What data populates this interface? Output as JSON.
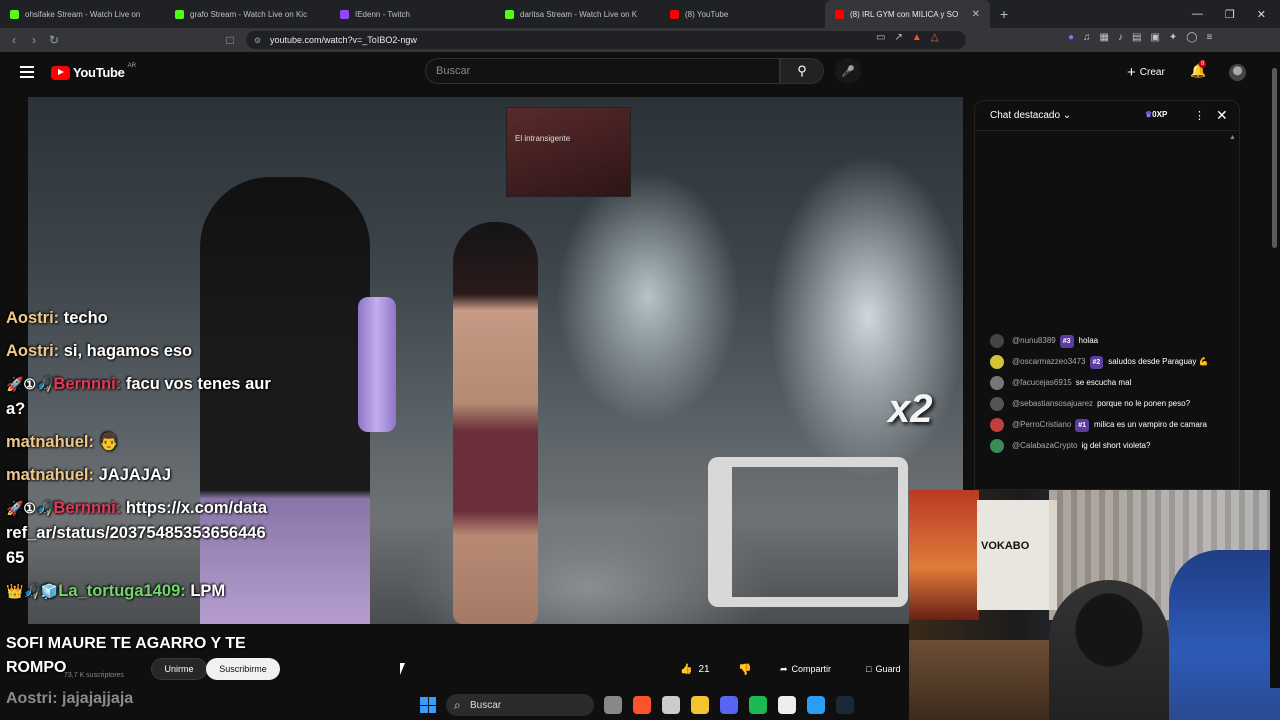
{
  "browser": {
    "tabs": [
      {
        "title": "ohsifake Stream - Watch Live on",
        "color": "#53fc18",
        "active": false
      },
      {
        "title": "grafo Stream - Watch Live on Kic",
        "color": "#53fc18",
        "active": false
      },
      {
        "title": "IEdenn - Twitch",
        "color": "#9146ff",
        "active": false
      },
      {
        "title": "daritsa Stream - Watch Live on K",
        "color": "#53fc18",
        "active": false
      },
      {
        "title": "(8) YouTube",
        "color": "#ff0000",
        "active": false
      },
      {
        "title": "(8) IRL GYM con MILICA y SO",
        "color": "#ff0000",
        "active": true
      }
    ],
    "new_tab": "+",
    "url": "youtube.com/watch?v=_ToIBO2-ngw"
  },
  "youtube": {
    "logo_text": "YouTube",
    "country": "AR",
    "search_placeholder": "Buscar",
    "create_label": "Crear",
    "notifications_count": "8"
  },
  "video": {
    "banner_text": "El intransigente",
    "overlay_badge": "x2",
    "chat_overlay": [
      {
        "badges": "",
        "nick": "Aostri:",
        "nick_style": "normal",
        "text": " techo"
      },
      {
        "badges": "",
        "nick": "Aostri:",
        "nick_style": "normal",
        "text": " si, hagamos eso"
      },
      {
        "badges": "🚀①🎣 ",
        "nick": "Bernnni:",
        "nick_style": "red",
        "text": " facu vos tenes aura?"
      },
      {
        "badges": "",
        "nick": "matnahuel:",
        "nick_style": "normal",
        "text": " 👨"
      },
      {
        "badges": "",
        "nick": "matnahuel:",
        "nick_style": "normal",
        "text": " JAJAJAJ"
      },
      {
        "badges": "🚀①🎣 ",
        "nick": "Bernnni:",
        "nick_style": "red",
        "text": " https://x.com/dataref_ar/status/2037548535365644665"
      },
      {
        "badges": "👑🎣🧊",
        "nick": "La_tortuga1409:",
        "nick_style": "green",
        "text": " LPM"
      }
    ],
    "subtitle_overlay": "SOFI MAURE TE AGARRO Y TE ROMPO",
    "bottom_chat_line": "Aostri: jajajajjaja"
  },
  "channel": {
    "subscribers": "73,7 K suscriptores",
    "join_label": "Unirme",
    "subscribe_label": "Suscribirme"
  },
  "actions": {
    "likes": "21",
    "share_label": "Compartir",
    "save_label": "Guard"
  },
  "live_chat": {
    "title": "Chat destacado",
    "xp": "0XP",
    "messages": [
      {
        "author": "@nunu8389",
        "rank": "#3",
        "text": "holaa",
        "avatar": "#444"
      },
      {
        "author": "@oscarmazzeo3473",
        "rank": "#2",
        "text": "saludos desde Paraguay 💪",
        "avatar": "#d4c23a"
      },
      {
        "author": "@facucejas6915",
        "rank": "",
        "text": "se escucha mal",
        "avatar": "#777"
      },
      {
        "author": "@sebastiansosajuarez",
        "rank": "",
        "text": "porque no le ponen peso?",
        "avatar": "#555"
      },
      {
        "author": "@PerroCristiano",
        "rank": "#1",
        "text": "milica es un vampiro de camara",
        "avatar": "#c04040"
      },
      {
        "author": "@CalabazaCrypto",
        "rank": "",
        "text": "ig del short violeta?",
        "avatar": "#3a8a5a"
      }
    ]
  },
  "webcam": {
    "poster_text": "VOKABO"
  },
  "taskbar": {
    "search_placeholder": "Buscar",
    "apps": [
      "#888888",
      "#fb542b",
      "#cccccc",
      "#f4c430",
      "#5865f2",
      "#1db954",
      "#eeeeee",
      "#2a9df4",
      "#1b2838"
    ]
  }
}
